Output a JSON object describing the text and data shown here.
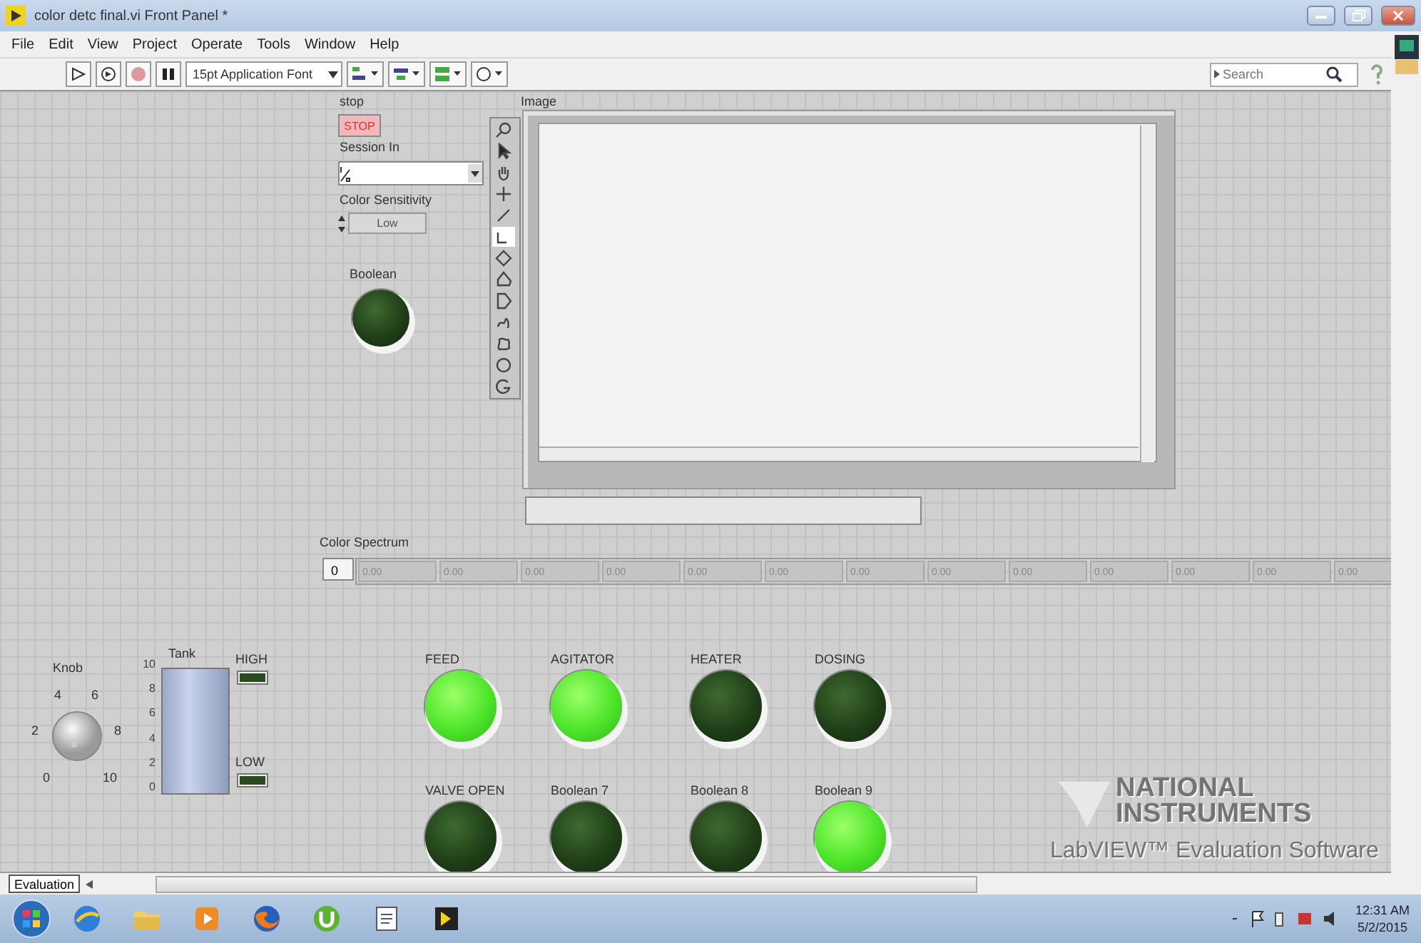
{
  "window": {
    "title": "color detc final.vi Front Panel *"
  },
  "menu": [
    "File",
    "Edit",
    "View",
    "Project",
    "Operate",
    "Tools",
    "Window",
    "Help"
  ],
  "toolbar": {
    "font": "15pt Application Font"
  },
  "search": {
    "placeholder": "Search"
  },
  "stop_button": {
    "label": "stop",
    "text": "STOP"
  },
  "session_in": {
    "label": "Session In"
  },
  "color_sensitivity": {
    "label": "Color Sensitivity",
    "value": "Low"
  },
  "boolean": {
    "label": "Boolean",
    "on": false
  },
  "image": {
    "label": "Image",
    "tools": [
      {
        "kind": "zoom",
        "selected": false
      },
      {
        "kind": "pointer",
        "selected": false
      },
      {
        "kind": "pan",
        "selected": false
      },
      {
        "kind": "point",
        "selected": false
      },
      {
        "kind": "line",
        "selected": false
      },
      {
        "kind": "angle",
        "selected": true
      },
      {
        "kind": "rotrect",
        "selected": false
      },
      {
        "kind": "polygon",
        "selected": false
      },
      {
        "kind": "dshape",
        "selected": false
      },
      {
        "kind": "freehand",
        "selected": false
      },
      {
        "kind": "blob",
        "selected": false
      },
      {
        "kind": "circle",
        "selected": false
      },
      {
        "kind": "hook",
        "selected": false
      }
    ]
  },
  "color_spectrum": {
    "label": "Color Spectrum",
    "index": "0",
    "values": [
      "0.00",
      "0.00",
      "0.00",
      "0.00",
      "0.00",
      "0.00",
      "0.00",
      "0.00",
      "0.00",
      "0.00",
      "0.00",
      "0.00",
      "0.00"
    ]
  },
  "knob": {
    "label": "Knob",
    "scale": [
      "0",
      "2",
      "4",
      "6",
      "8",
      "10"
    ]
  },
  "tank": {
    "label": "Tank",
    "scale": [
      "10",
      "8",
      "6",
      "4",
      "2",
      "0"
    ]
  },
  "level_indicators": [
    {
      "label": "HIGH",
      "on": false
    },
    {
      "label": "LOW",
      "on": false
    }
  ],
  "leds": [
    {
      "label": "FEED",
      "on": true
    },
    {
      "label": "AGITATOR",
      "on": true
    },
    {
      "label": "HEATER",
      "on": false
    },
    {
      "label": "DOSING",
      "on": false
    },
    {
      "label": "VALVE OPEN",
      "on": false
    },
    {
      "label": "Boolean 7",
      "on": false
    },
    {
      "label": "Boolean 8",
      "on": false
    },
    {
      "label": "Boolean 9",
      "on": true
    }
  ],
  "branding": {
    "line1": "NATIONAL",
    "line2": "INSTRUMENTS",
    "line3": "LabVIEW™ Evaluation Software"
  },
  "scroll_tab": "Evaluation",
  "taskbar": {
    "time": "12:31 AM",
    "date": "5/2/2015"
  }
}
